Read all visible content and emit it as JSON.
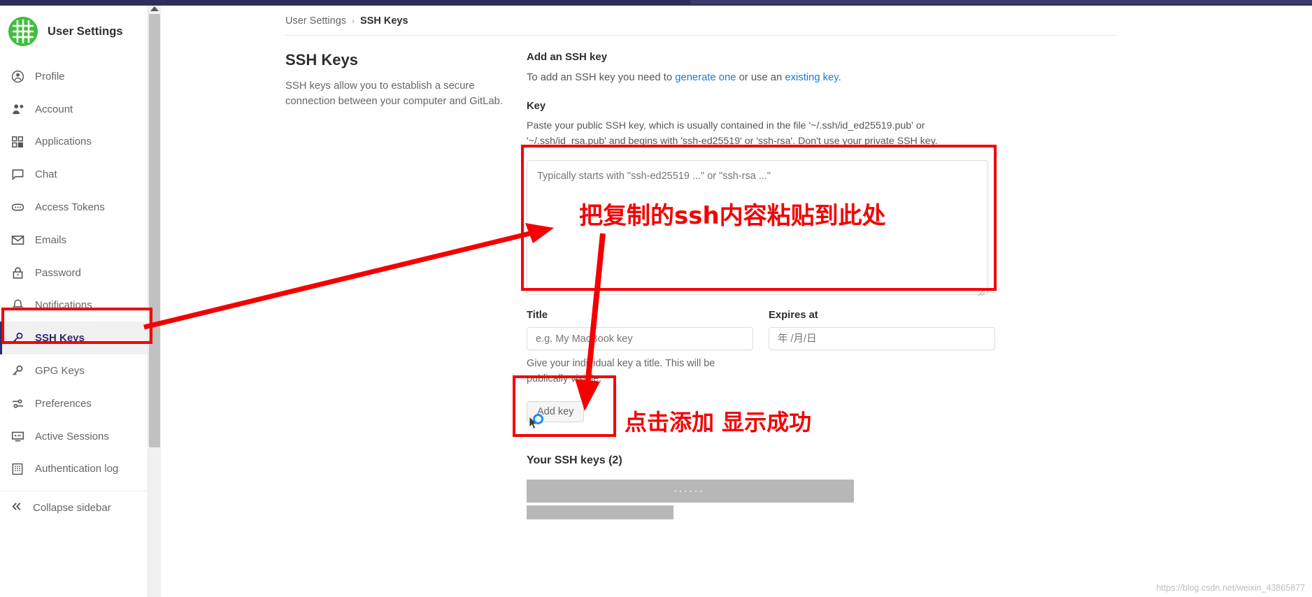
{
  "sidebar": {
    "brand": {
      "title": "User Settings",
      "logo": "gitlab-tanuki-logo"
    },
    "items": [
      {
        "label": "Profile",
        "icon": "user-circle-icon",
        "active": false
      },
      {
        "label": "Account",
        "icon": "user-gear-icon",
        "active": false
      },
      {
        "label": "Applications",
        "icon": "apps-grid-icon",
        "active": false
      },
      {
        "label": "Chat",
        "icon": "chat-bubble-icon",
        "active": false
      },
      {
        "label": "Access Tokens",
        "icon": "token-pill-icon",
        "active": false
      },
      {
        "label": "Emails",
        "icon": "envelope-icon",
        "active": false
      },
      {
        "label": "Password",
        "icon": "lock-icon",
        "active": false
      },
      {
        "label": "Notifications",
        "icon": "bell-icon",
        "active": false
      },
      {
        "label": "SSH Keys",
        "icon": "key-icon",
        "active": true
      },
      {
        "label": "GPG Keys",
        "icon": "key-icon",
        "active": false
      },
      {
        "label": "Preferences",
        "icon": "sliders-icon",
        "active": false
      },
      {
        "label": "Active Sessions",
        "icon": "monitor-icon",
        "active": false
      },
      {
        "label": "Authentication log",
        "icon": "log-list-icon",
        "active": false
      }
    ],
    "collapse": {
      "label": "Collapse sidebar",
      "icon": "chevron-double-left-icon"
    }
  },
  "breadcrumb": {
    "first": "User Settings",
    "separator": "›",
    "last": "SSH Keys"
  },
  "page": {
    "title": "SSH Keys",
    "description": "SSH keys allow you to establish a secure connection between your computer and GitLab."
  },
  "form": {
    "section_title": "Add an SSH key",
    "intro_prefix": "To add an SSH key you need to ",
    "intro_link1": "generate one",
    "intro_middle": " or use an ",
    "intro_link2": "existing key",
    "intro_suffix": ".",
    "key_label": "Key",
    "key_hint": "Paste your public SSH key, which is usually contained in the file '~/.ssh/id_ed25519.pub' or '~/.ssh/id_rsa.pub' and begins with 'ssh-ed25519' or 'ssh-rsa'. Don't use your private SSH key.",
    "key_placeholder": "Typically starts with \"ssh-ed25519 ...\" or \"ssh-rsa ...\"",
    "key_value": "",
    "title_label": "Title",
    "title_placeholder": "e.g. My MacBook key",
    "title_value": "",
    "expires_label": "Expires at",
    "expires_placeholder": "年 /月/日",
    "expires_value": "",
    "title_help": "Give your individual key a title. This will be publically visible.",
    "add_button": "Add key"
  },
  "keys_list": {
    "heading": "Your SSH keys (2)",
    "redacted_dots": "······"
  },
  "annotations": {
    "paste_note": "把复制的ssh内容粘贴到此处",
    "click_note": "点击添加  显示成功",
    "accent_color": "#f40000"
  },
  "watermark": {
    "text": "https://blog.csdn.net/weixin_43865877"
  }
}
